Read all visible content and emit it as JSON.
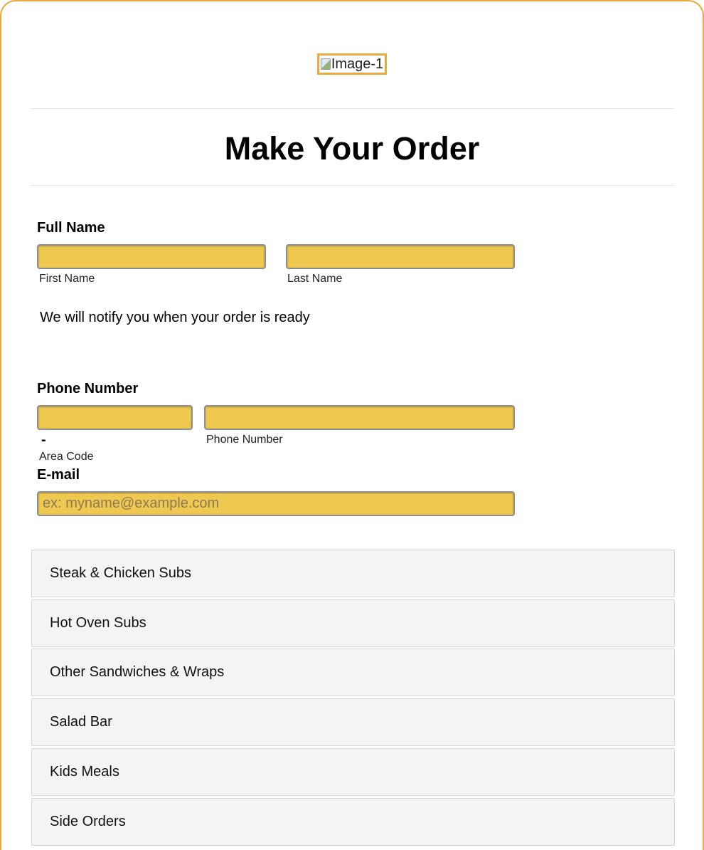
{
  "header": {
    "logo_alt": "Image-1",
    "title": "Make Your Order"
  },
  "form": {
    "full_name": {
      "label": "Full Name",
      "first_name_value": "",
      "first_name_sublabel": "First Name",
      "last_name_value": "",
      "last_name_sublabel": "Last Name"
    },
    "notice": "We will notify you when your order is ready",
    "phone": {
      "label": "Phone Number",
      "area_code_value": "",
      "separator": "-",
      "area_code_sublabel": "Area Code",
      "number_value": "",
      "number_sublabel": "Phone Number"
    },
    "email": {
      "label": "E-mail",
      "value": "",
      "placeholder": "ex: myname@example.com"
    }
  },
  "categories": [
    {
      "label": "Steak & Chicken Subs"
    },
    {
      "label": "Hot Oven Subs"
    },
    {
      "label": "Other Sandwiches & Wraps"
    },
    {
      "label": "Salad Bar"
    },
    {
      "label": "Kids Meals"
    },
    {
      "label": "Side Orders"
    }
  ],
  "colors": {
    "accent_border": "#e9ab41",
    "input_fill": "#efc850",
    "category_bg": "#f4f4f4"
  }
}
